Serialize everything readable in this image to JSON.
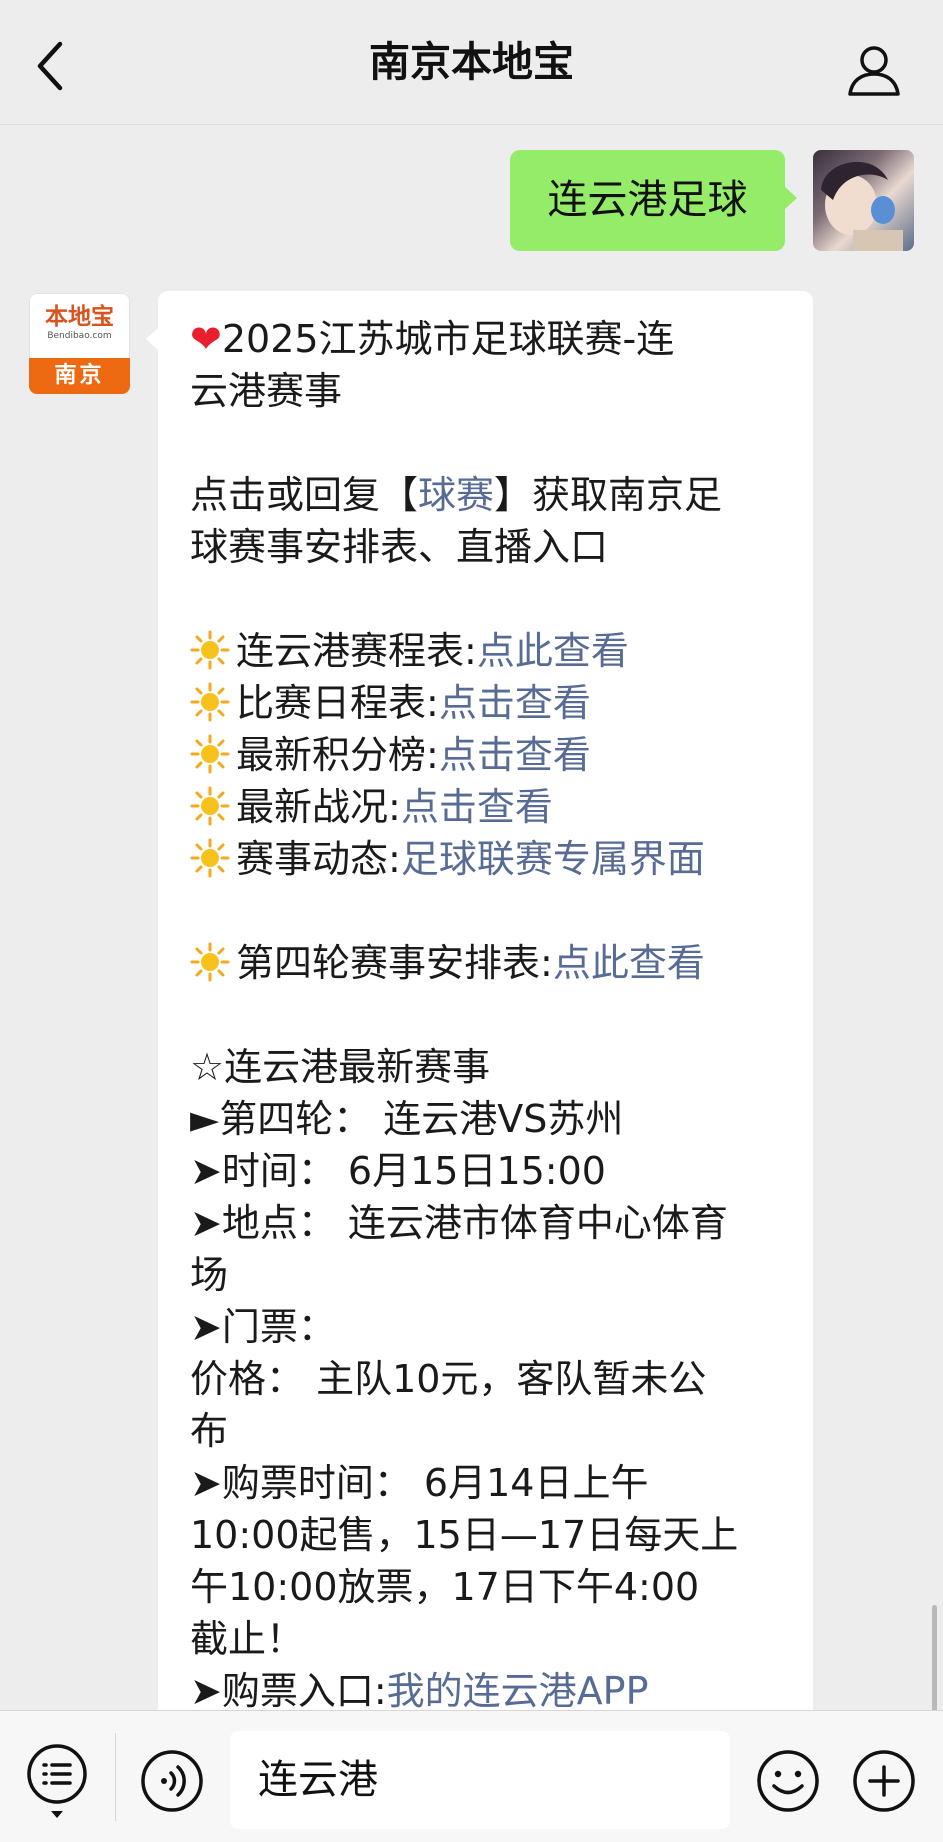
{
  "header": {
    "title": "南京本地宝"
  },
  "outgoing": {
    "text": "连云港足球"
  },
  "sender": {
    "logo_cn": "本地宝",
    "logo_en": "Bendibao.com",
    "city": "南京"
  },
  "message": {
    "title_line1": "2025江苏城市足球联赛-连",
    "title_line2": "云港赛事",
    "reply_line1_pre": "点击或回复【",
    "reply_keyword": "球赛",
    "reply_line1_post": "】获取南京足",
    "reply_line2": "球赛事安排表、直播入口",
    "links": [
      {
        "label": "连云港赛程表:",
        "link": "点此查看"
      },
      {
        "label": "比赛日程表:",
        "link": "点击查看"
      },
      {
        "label": "最新积分榜:",
        "link": "点击查看"
      },
      {
        "label": "最新战况:",
        "link": "点击查看"
      },
      {
        "label": "赛事动态:",
        "link": "足球联赛专属界面"
      }
    ],
    "round4": {
      "label": "第四轮赛事安排表:",
      "link": "点此查看"
    },
    "latest_title": "☆连云港最新赛事",
    "round": "►第四轮： 连云港VS苏州",
    "time": "➤时间： 6月15日15:00",
    "place_line1": "➤地点： 连云港市体育中心体育",
    "place_line2": "场",
    "ticket": "➤门票：",
    "price_line1": "价格： 主队10元，客队暂未公",
    "price_line2": "布",
    "buy_time_line1": "➤购票时间： 6月14日上午",
    "buy_time_line2": "10:00起售，15日—17日每天上",
    "buy_time_line3": "午10:00放票，17日下午4:00",
    "buy_time_line4": "截止！",
    "buy_entry_label": "➤购票入口:",
    "buy_entry_link": "我的连云港APP"
  },
  "input_bar": {
    "value": "连云港"
  },
  "colors": {
    "background": "#ededed",
    "outgoing_bubble": "#95ec69",
    "link": "#576b95",
    "incoming_bubble": "#ffffff"
  },
  "icons": [
    "back-arrow-icon",
    "profile-icon",
    "sun-icon",
    "heart-icon",
    "menu-list-icon",
    "voice-icon",
    "emoji-icon",
    "plus-icon"
  ]
}
